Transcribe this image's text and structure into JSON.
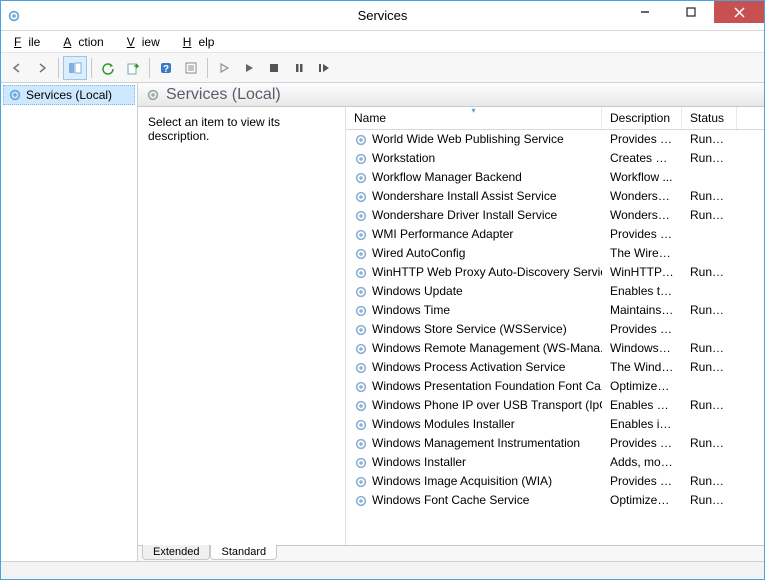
{
  "window": {
    "title": "Services"
  },
  "menu": {
    "file": "File",
    "action": "Action",
    "view": "View",
    "help": "Help"
  },
  "tree": {
    "root": "Services (Local)"
  },
  "detail": {
    "header": "Services (Local)",
    "hint": "Select an item to view its description."
  },
  "columns": {
    "name": "Name",
    "description": "Description",
    "status": "Status"
  },
  "tabs": {
    "extended": "Extended",
    "standard": "Standard"
  },
  "services": [
    {
      "name": "World Wide Web Publishing Service",
      "desc": "Provides W...",
      "status": "Running"
    },
    {
      "name": "Workstation",
      "desc": "Creates and...",
      "status": "Running"
    },
    {
      "name": "Workflow Manager Backend",
      "desc": "Workflow ...",
      "status": ""
    },
    {
      "name": "Wondershare Install Assist Service",
      "desc": "Wondershar...",
      "status": "Running"
    },
    {
      "name": "Wondershare Driver Install Service",
      "desc": "Wondershar...",
      "status": "Running"
    },
    {
      "name": "WMI Performance Adapter",
      "desc": "Provides pe...",
      "status": ""
    },
    {
      "name": "Wired AutoConfig",
      "desc": "The Wired ...",
      "status": ""
    },
    {
      "name": "WinHTTP Web Proxy Auto-Discovery Service",
      "desc": "WinHTTP i...",
      "status": "Running"
    },
    {
      "name": "Windows Update",
      "desc": "Enables the ...",
      "status": ""
    },
    {
      "name": "Windows Time",
      "desc": "Maintains d...",
      "status": "Running"
    },
    {
      "name": "Windows Store Service (WSService)",
      "desc": "Provides inf...",
      "status": ""
    },
    {
      "name": "Windows Remote Management (WS-Mana...",
      "desc": "Windows R...",
      "status": "Running"
    },
    {
      "name": "Windows Process Activation Service",
      "desc": "The Windo...",
      "status": "Running"
    },
    {
      "name": "Windows Presentation Foundation Font Ca...",
      "desc": "Optimizes p...",
      "status": ""
    },
    {
      "name": "Windows Phone IP over USB Transport (IpO...",
      "desc": "Enables co...",
      "status": "Running"
    },
    {
      "name": "Windows Modules Installer",
      "desc": "Enables inst...",
      "status": ""
    },
    {
      "name": "Windows Management Instrumentation",
      "desc": "Provides a c...",
      "status": "Running"
    },
    {
      "name": "Windows Installer",
      "desc": "Adds, modi...",
      "status": ""
    },
    {
      "name": "Windows Image Acquisition (WIA)",
      "desc": "Provides im...",
      "status": "Running"
    },
    {
      "name": "Windows Font Cache Service",
      "desc": "Optimizes p...",
      "status": "Running"
    }
  ]
}
